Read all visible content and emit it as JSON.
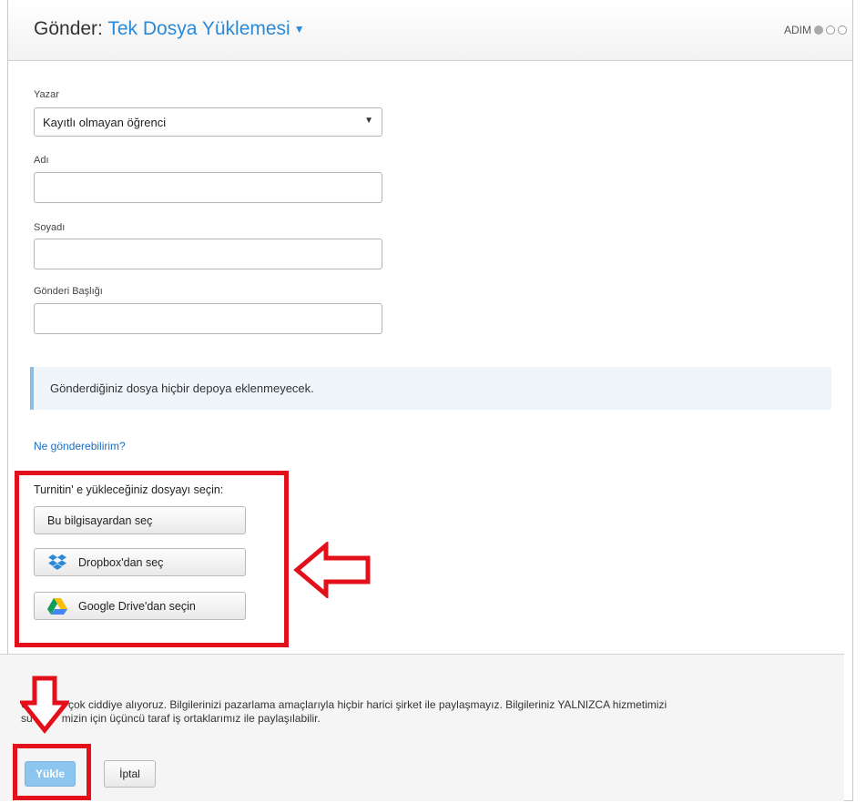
{
  "header": {
    "prefix": "Gönder:",
    "title": "Tek Dosya Yüklemesi",
    "step_label": "ADIM",
    "steps_total": 3,
    "steps_completed": 1
  },
  "form": {
    "author_label": "Yazar",
    "author_value": "Kayıtlı olmayan öğrenci",
    "first_name_label": "Adı",
    "first_name_value": "",
    "last_name_label": "Soyadı",
    "last_name_value": "",
    "title_label": "Gönderi Başlığı",
    "title_value": ""
  },
  "notice": "Gönderdiğiniz dosya hiçbir depoya eklenmeyecek.",
  "help_link": "Ne gönderebilirim?",
  "upload": {
    "title": "Turnitin' e yükleceğiniz dosyayı seçin:",
    "computer_button": "Bu bilgisayardan seç",
    "dropbox_button": "Dropbox'dan seç",
    "gdrive_button": "Google Drive'dan seçin"
  },
  "footer": {
    "privacy_line1": "izi çok ciddiye alıyoruz. Bilgilerinizi pazarlama amaçlarıyla hiçbir harici şirket ile paylaşmayız. Bilgileriniz YALNIZCA hizmetimizi",
    "privacy_line1_lead": "G",
    "privacy_line2_lead": "su",
    "privacy_line2": "mizin için üçüncü taraf iş ortaklarımız ile paylaşılabilir.",
    "upload_button": "Yükle",
    "cancel_button": "İptal"
  },
  "colors": {
    "accent": "#2a8ad8",
    "annotation": "#e3101b",
    "upload_button_bg": "#8cc6ef"
  }
}
